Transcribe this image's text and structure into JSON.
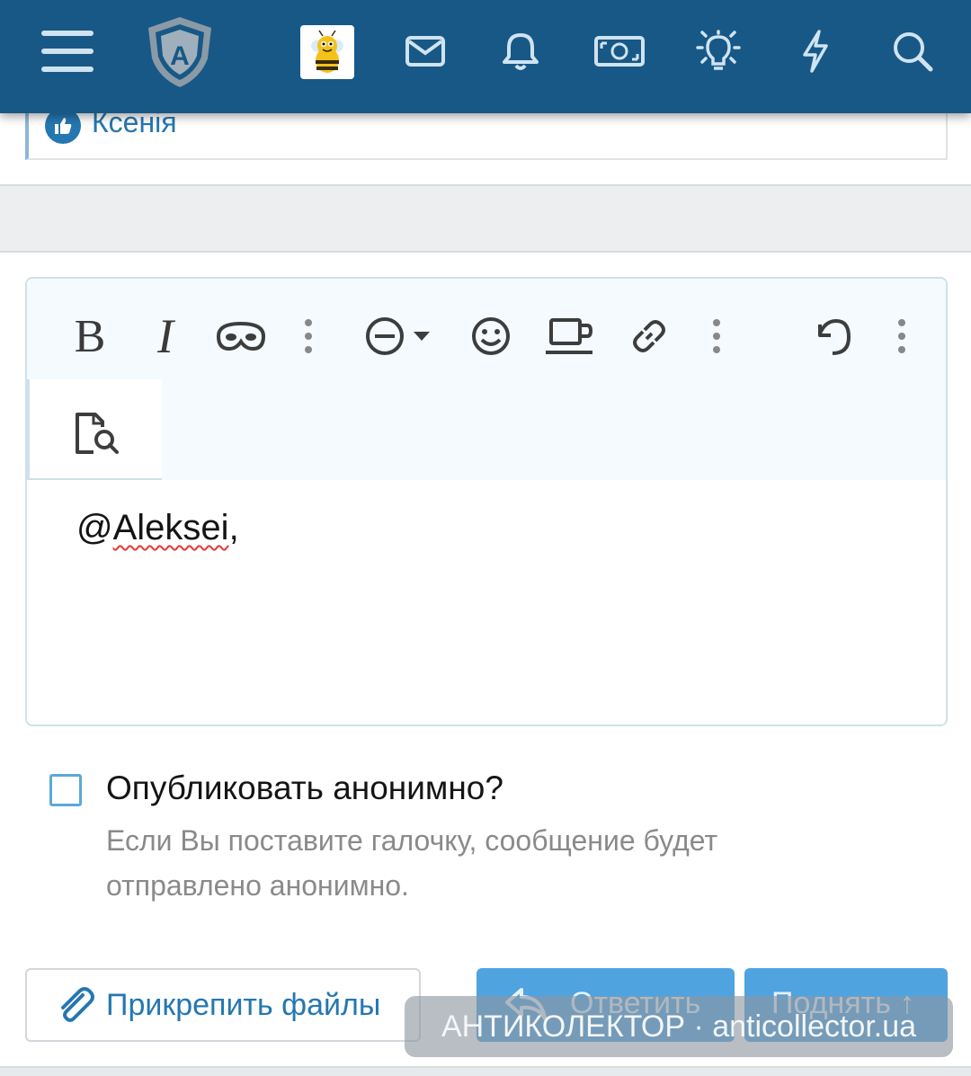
{
  "header": {
    "icons": [
      "menu-icon",
      "shield-logo-icon",
      "bee-avatar",
      "mail-icon",
      "bell-icon",
      "money-icon",
      "lightbulb-icon",
      "lightning-icon",
      "search-icon"
    ],
    "logo_letter": "A",
    "color": "#185886"
  },
  "liked_by": {
    "name": "Ксенія"
  },
  "editor": {
    "toolbar": {
      "bold_label": "B",
      "italic_label": "I",
      "icons": [
        "bold-icon",
        "italic-icon",
        "mask-icon",
        "more-vertical-icon",
        "minus-circle-icon",
        "emoji-icon",
        "cup-icon",
        "link-icon",
        "more-vertical-icon",
        "undo-icon",
        "more-vertical-icon",
        "preview-icon"
      ]
    },
    "content_prefix": "@",
    "content_user": "Aleksei",
    "content_suffix": ","
  },
  "anonymous": {
    "label": "Опубликовать анонимно?",
    "hint": "Если Вы поставите галочку, сообщение будет отправлено анонимно.",
    "checked": false
  },
  "buttons": {
    "attach": "Прикрепить файлы",
    "reply": "Ответить",
    "bump": "Поднять ↑"
  },
  "watermark": "АНТИКОЛЕКТОР · anticollector.ua"
}
